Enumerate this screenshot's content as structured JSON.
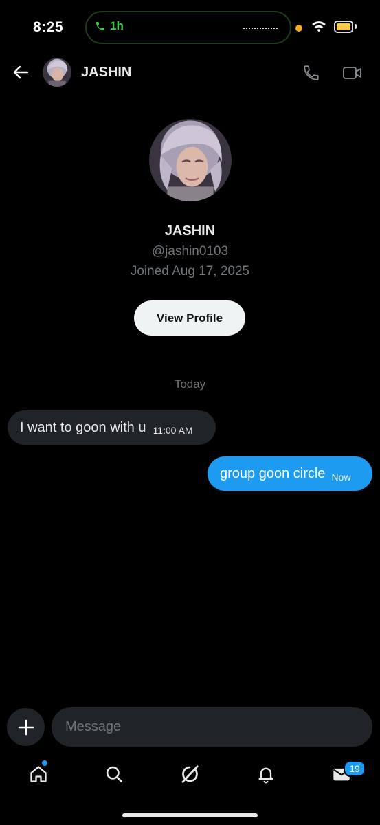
{
  "status_bar": {
    "time": "8:25",
    "call_duration": "1h",
    "accent_call": "#35d04a",
    "battery_color": "#f5c84b"
  },
  "header": {
    "name": "JASHIN",
    "icons": [
      "back-arrow-icon",
      "phone-icon",
      "video-icon"
    ]
  },
  "profile": {
    "name": "JASHIN",
    "handle": "@jashin0103",
    "joined": "Joined Aug 17, 2025",
    "view_profile_label": "View Profile"
  },
  "conversation": {
    "day_label": "Today",
    "messages": [
      {
        "direction": "incoming",
        "text": "I want to goon with u",
        "time": "11:00 AM"
      },
      {
        "direction": "outgoing",
        "text": "group goon circle",
        "time": "Now"
      }
    ]
  },
  "composer": {
    "placeholder": "Message"
  },
  "tab_bar": {
    "items": [
      "home-icon",
      "search-icon",
      "grok-icon",
      "notifications-icon",
      "messages-icon"
    ],
    "messages_badge": "19"
  },
  "colors": {
    "accent": "#1d9bf0",
    "background": "#000000",
    "bubble_incoming": "#202327",
    "muted_text": "#71767b"
  }
}
